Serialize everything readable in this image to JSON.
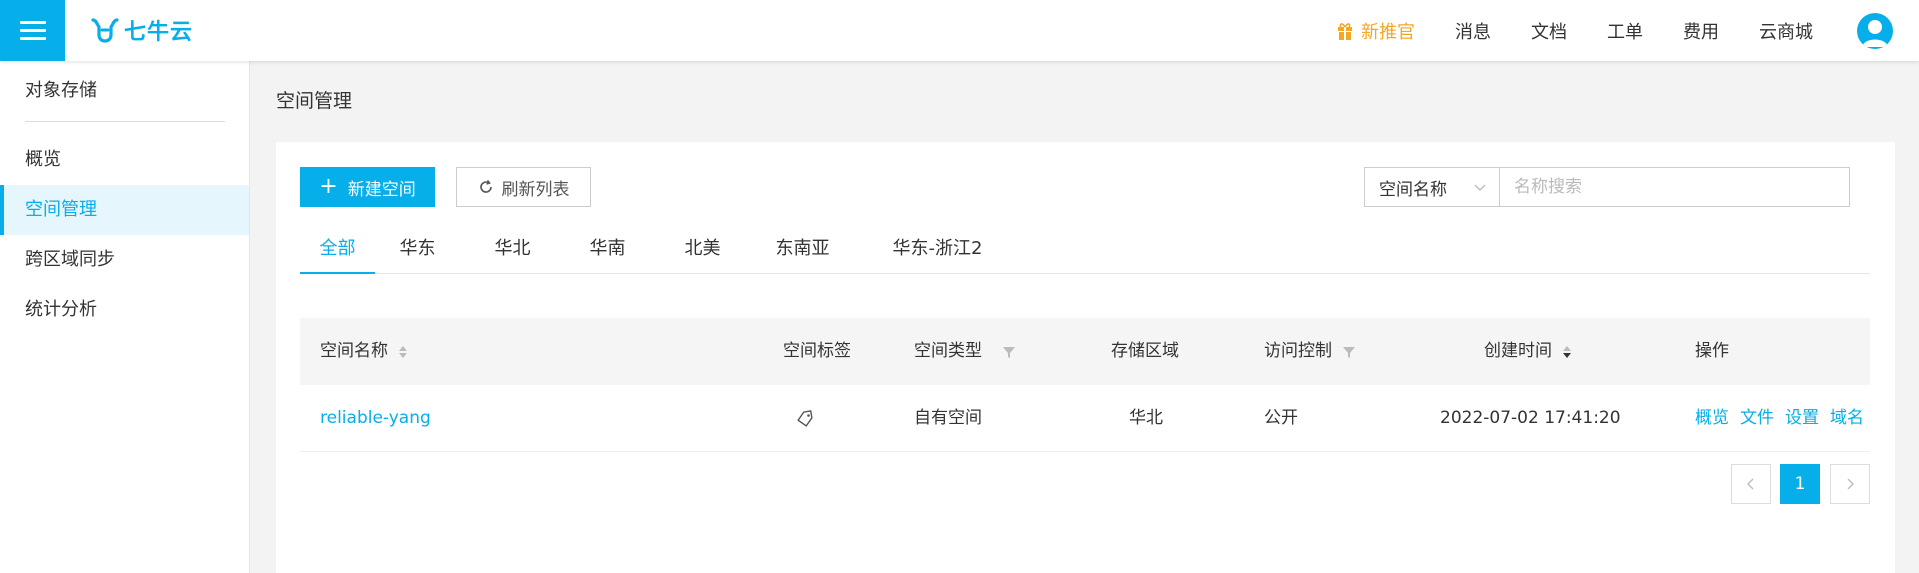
{
  "header": {
    "logo_text": "七牛云",
    "nav": [
      {
        "label": "新推官"
      },
      {
        "label": "消息"
      },
      {
        "label": "文档"
      },
      {
        "label": "工单"
      },
      {
        "label": "费用"
      },
      {
        "label": "云商城"
      }
    ],
    "accent": "#06aeea",
    "promo_color": "#f5a623"
  },
  "sidebar": {
    "title": "对象存储",
    "items": [
      {
        "label": "概览",
        "active": false
      },
      {
        "label": "空间管理",
        "active": true
      },
      {
        "label": "跨区域同步",
        "active": false
      },
      {
        "label": "统计分析",
        "active": false
      }
    ]
  },
  "main": {
    "title": "空间管理",
    "new_button": "新建空间",
    "refresh_button": "刷新列表",
    "search": {
      "select_value": "空间名称",
      "placeholder": "名称搜索",
      "value": ""
    },
    "tabs": [
      {
        "label": "全部",
        "active": true
      },
      {
        "label": "华东"
      },
      {
        "label": "华北"
      },
      {
        "label": "华南"
      },
      {
        "label": "北美"
      },
      {
        "label": "东南亚"
      },
      {
        "label": "华东-浙江2"
      }
    ],
    "table": {
      "columns": [
        "空间名称",
        "空间标签",
        "空间类型",
        "存储区域",
        "访问控制",
        "创建时间",
        "操作"
      ],
      "rows": [
        {
          "name": "reliable-yang",
          "type": "自有空间",
          "region": "华北",
          "access": "公开",
          "created": "2022-07-02 17:41:20",
          "actions": [
            "概览",
            "文件",
            "设置",
            "域名"
          ]
        }
      ]
    },
    "pagination": {
      "current": "1"
    }
  }
}
